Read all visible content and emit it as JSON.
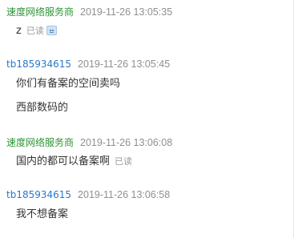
{
  "chat": {
    "messages": [
      {
        "sender": "速度网络服务商",
        "time": "2019-11-26 13:05:35",
        "lines": [
          "z"
        ],
        "status": "已读",
        "sticker_icon": "smiley-sticker-icon"
      },
      {
        "sender": "tb185934615",
        "time": "2019-11-26 13:05:45",
        "lines": [
          "你们有备案的空间卖吗",
          "西部数码的"
        ]
      },
      {
        "sender": "速度网络服务商",
        "time": "2019-11-26 13:06:08",
        "lines": [
          "国内的都可以备案啊"
        ],
        "status": "已读"
      },
      {
        "sender": "tb185934615",
        "time": "2019-11-26 13:06:58",
        "lines": [
          "我不想备案"
        ]
      }
    ]
  },
  "colors": {
    "seller_name": "#2d9434",
    "buyer_name": "#2a78c8",
    "timestamp": "#8f8f8f",
    "read_status": "#9a9a9a"
  }
}
